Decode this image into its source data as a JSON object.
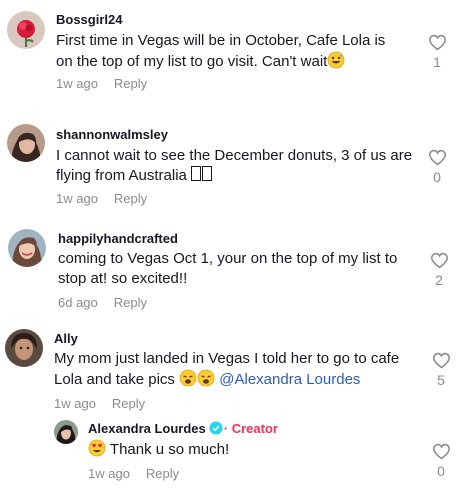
{
  "comments": [
    {
      "username": "Bossgirl24",
      "text": "First time in Vegas will be in October, Cafe Lola is on the top of my list to go visit. Can't wait",
      "emoji": "grinning-face-sweat",
      "time": "1w ago",
      "reply_label": "Reply",
      "likes": "1",
      "avatar_icon": "rose-avatar-icon"
    },
    {
      "username": "shannonwalmsley",
      "text": "I cannot wait to see the December donuts, 3 of us are flying from Australia",
      "emoji": "unsupported-glyph-boxes",
      "time": "1w ago",
      "reply_label": "Reply",
      "likes": "0",
      "avatar_icon": "profile-photo-avatar-icon"
    },
    {
      "username": "happilyhandcrafted",
      "text": "coming to Vegas Oct 1, your on the top of my list to stop at! so excited!!",
      "time": "6d ago",
      "reply_label": "Reply",
      "likes": "2",
      "avatar_icon": "profile-photo-avatar-icon"
    },
    {
      "username": "Ally",
      "text": "My mom just landed in Vegas I told her to go to cafe Lola and take pics",
      "emoji": "weary-face x2",
      "mention": "@Alexandra Lourdes",
      "time": "1w ago",
      "reply_label": "Reply",
      "likes": "5",
      "avatar_icon": "profile-photo-avatar-icon"
    }
  ],
  "reply": {
    "username": "Alexandra Lourdes",
    "creator_label": "· Creator",
    "emoji": "heart-eyes-face",
    "text": "Thank u so much!",
    "time": "1w ago",
    "reply_label": "Reply",
    "likes": "0",
    "avatar_icon": "profile-photo-avatar-icon"
  },
  "colors": {
    "text": "#161823",
    "meta": "#8a8b91",
    "mention": "#2b5db9",
    "creator": "#fe2c55",
    "verified": "#20d5ec"
  }
}
